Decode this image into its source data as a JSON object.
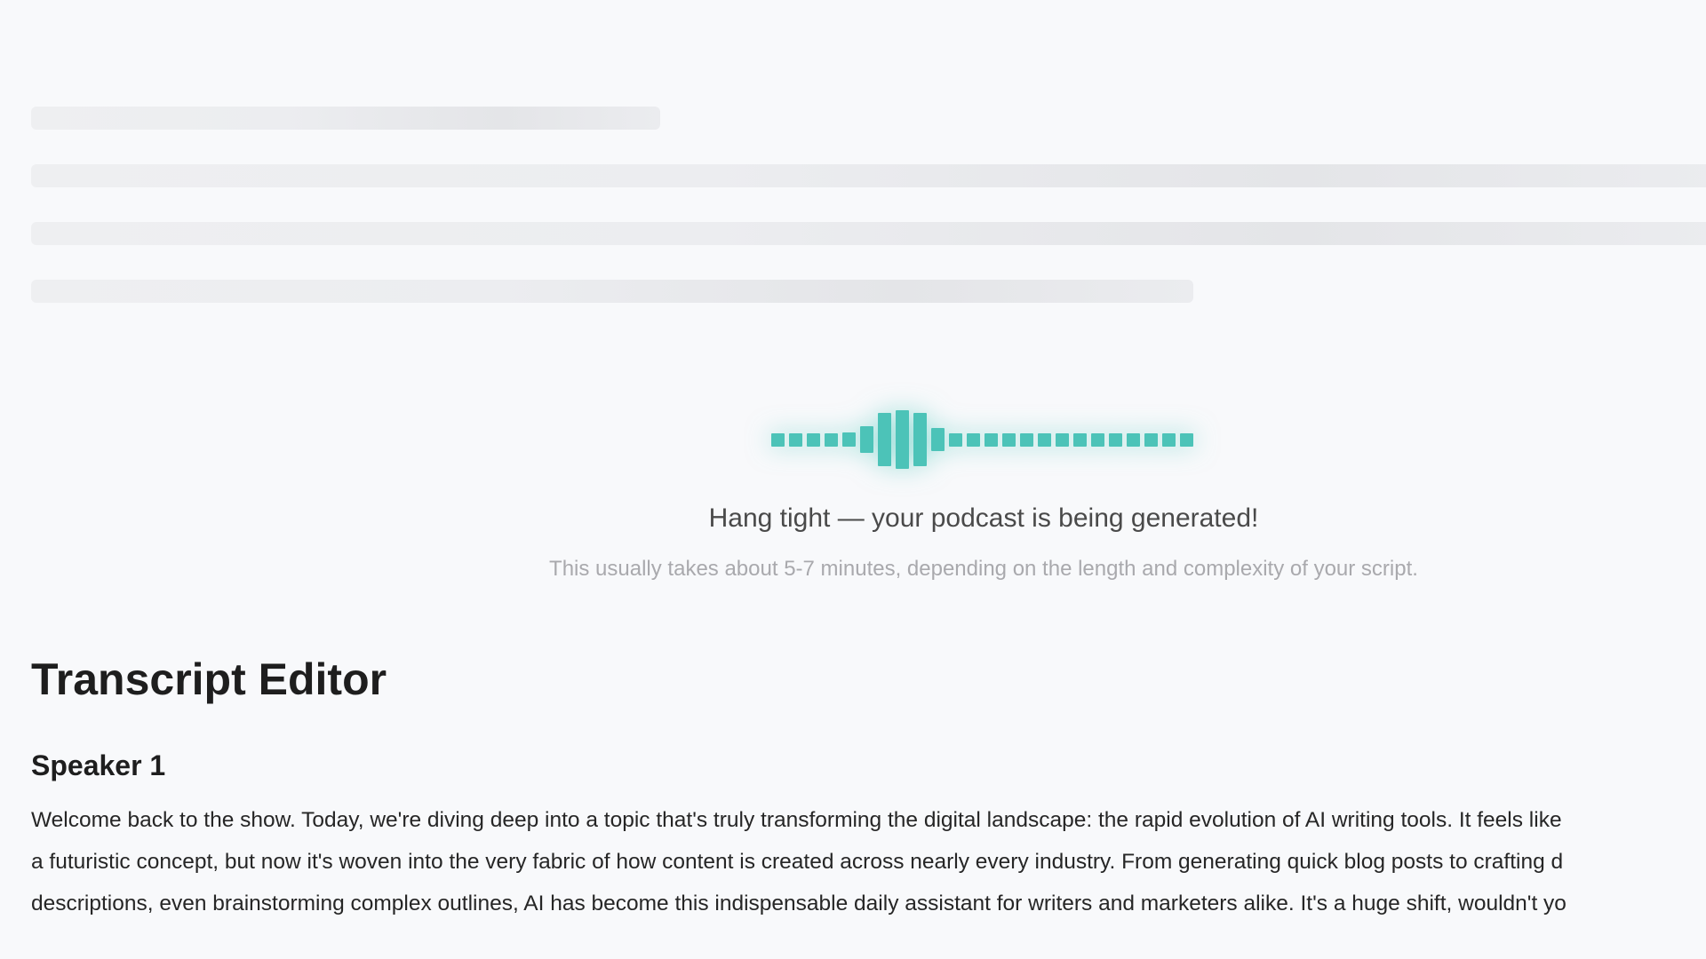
{
  "loader": {
    "title": "Hang tight — your podcast is being generated!",
    "subtitle": "This usually takes about 5-7 minutes, depending on the length and complexity of your script.",
    "accent_color": "#4cc3b8"
  },
  "editor": {
    "title": "Transcript Editor",
    "speaker": "Speaker 1",
    "lines": [
      "Welcome back to the show. Today, we're diving deep into a topic that's truly transforming the digital landscape: the rapid evolution of AI writing tools. It feels like",
      "a futuristic concept, but now it's woven into the very fabric of how content is created across nearly every industry. From generating quick blog posts to crafting d",
      "descriptions, even brainstorming complex outlines, AI has become this indispensable daily assistant for writers and marketers alike. It's a huge shift, wouldn't yo"
    ]
  }
}
